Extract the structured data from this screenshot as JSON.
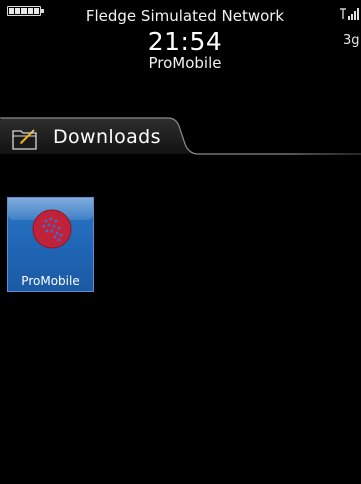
{
  "status_bar": {
    "carrier": "Fledge Simulated Network",
    "time": "21:54",
    "network_type": "3g",
    "battery_icon": "battery-full-icon",
    "signal_icon": "signal-strength-icon"
  },
  "app_title": "ProMobile",
  "folder_tab": {
    "label": "Downloads",
    "icon": "folder-icon"
  },
  "apps": [
    {
      "label": "ProMobile",
      "icon": "promobile-logo-icon",
      "selected": true
    }
  ],
  "colors": {
    "background": "#000000",
    "tile_blue": "#1f64b3",
    "icon_red": "#c0223a"
  }
}
